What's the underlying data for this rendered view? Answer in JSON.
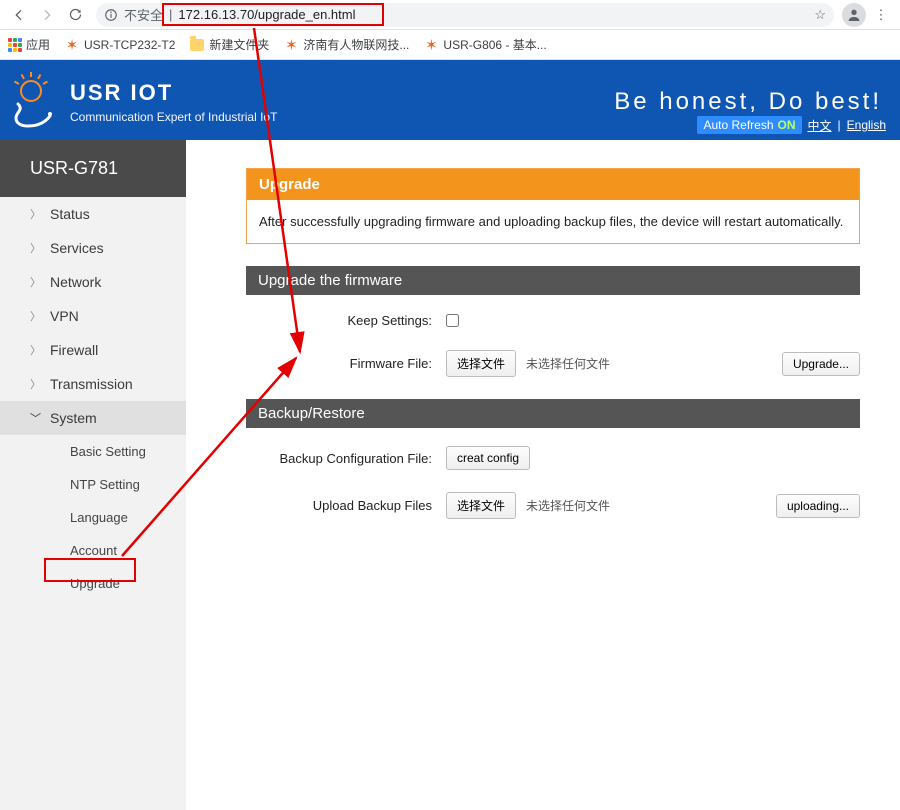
{
  "browser": {
    "insecure_label": "不安全",
    "url": "172.16.13.70/upgrade_en.html",
    "apps_label": "应用",
    "bookmarks": [
      {
        "icon": "stick",
        "label": "USR-TCP232-T2"
      },
      {
        "icon": "folder",
        "label": "新建文件夹"
      },
      {
        "icon": "stick",
        "label": "济南有人物联网技..."
      },
      {
        "icon": "stick",
        "label": "USR-G806 - 基本..."
      }
    ]
  },
  "brand": {
    "title": "USR IOT",
    "subtitle": "Communication Expert of Industrial IoT",
    "slogan": "Be honest, Do best!"
  },
  "header_tools": {
    "auto_refresh_label": "Auto Refresh",
    "auto_refresh_state": "ON",
    "lang_cn": "中文",
    "lang_en": "English"
  },
  "sidebar": {
    "device": "USR-G781",
    "items": [
      {
        "label": "Status"
      },
      {
        "label": "Services"
      },
      {
        "label": "Network"
      },
      {
        "label": "VPN"
      },
      {
        "label": "Firewall"
      },
      {
        "label": "Transmission"
      },
      {
        "label": "System",
        "expanded": true
      }
    ],
    "subitems": [
      {
        "label": "Basic Setting"
      },
      {
        "label": "NTP Setting"
      },
      {
        "label": "Language"
      },
      {
        "label": "Account"
      },
      {
        "label": "Upgrade",
        "active": true
      }
    ]
  },
  "panel": {
    "title": "Upgrade",
    "note": "After successfully upgrading firmware and uploading backup files, the device will restart automatically."
  },
  "firmware": {
    "section_title": "Upgrade the firmware",
    "keep_settings_label": "Keep Settings:",
    "file_label": "Firmware File:",
    "choose_btn": "选择文件",
    "no_file": "未选择任何文件",
    "upgrade_btn": "Upgrade..."
  },
  "backup": {
    "section_title": "Backup/Restore",
    "backup_label": "Backup Configuration File:",
    "create_btn": "creat config",
    "upload_label": "Upload Backup Files",
    "choose_btn": "选择文件",
    "no_file": "未选择任何文件",
    "uploading_btn": "uploading..."
  }
}
